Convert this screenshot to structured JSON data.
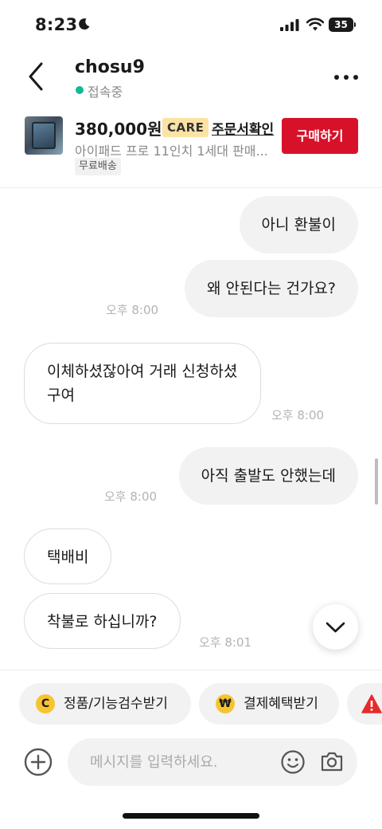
{
  "status_bar": {
    "time": "8:23",
    "battery": "35"
  },
  "header": {
    "username": "chosu9",
    "presence": "접속중"
  },
  "product": {
    "price": "380,000원",
    "care_badge": "CARE",
    "order_link": "주문서확인",
    "title": "아이패드 프로 11인치 1세대 판매...",
    "shipping_badge": "무료배송",
    "buy_button": "구매하기"
  },
  "messages": [
    {
      "sender": "me",
      "text": "아니 환불이"
    },
    {
      "sender": "me",
      "text": "왜 안된다는 건가요?",
      "time": "오후 8:00"
    },
    {
      "sender": "other",
      "text": "이체하셨잖아여 거래 신청하셨구여",
      "time": "오후 8:00"
    },
    {
      "sender": "me",
      "text": "아직 출발도 안했는데",
      "time": "오후 8:00"
    },
    {
      "sender": "other",
      "text": "택배비"
    },
    {
      "sender": "other",
      "text": "착불로 하십니까?",
      "time": "오후 8:01"
    }
  ],
  "quick_actions": [
    {
      "icon_text": "C",
      "label": "정품/기능검수받기"
    },
    {
      "icon_text": "₩",
      "label": "결제혜택받기"
    }
  ],
  "composer": {
    "placeholder": "메시지를 입력하세요."
  },
  "colors": {
    "buy_button": "#d8112b",
    "online_dot": "#14b896",
    "care_badge": "#fbe3a6",
    "chip_icon": "#f7c431",
    "warning": "#e52b2b"
  },
  "icons": [
    "moon-icon",
    "signal-icon",
    "wifi-icon",
    "battery-icon",
    "back-arrow-icon",
    "more-icon",
    "chevron-down-icon",
    "warning-icon",
    "plus-icon",
    "emoji-icon",
    "camera-icon"
  ]
}
